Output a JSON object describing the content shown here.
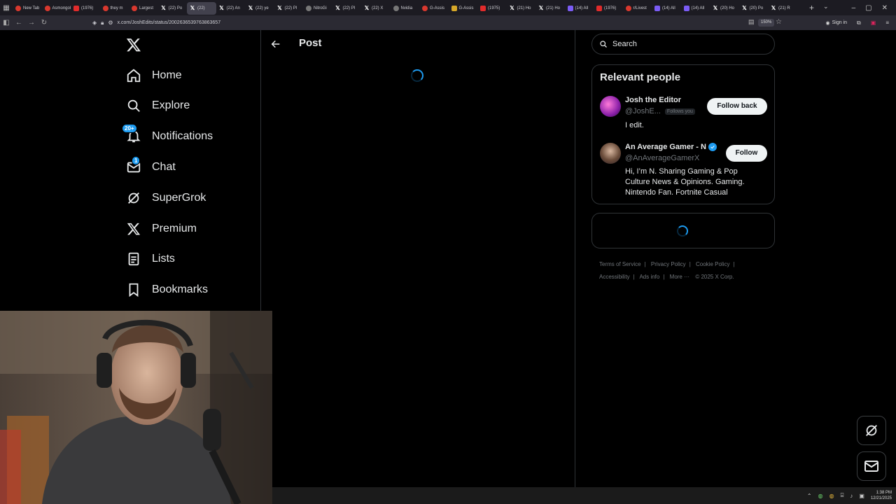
{
  "browser": {
    "tabs": [
      {
        "label": "New Tab",
        "icon": "red"
      },
      {
        "label": "Asmongold",
        "icon": "red"
      },
      {
        "label": "(1976)",
        "icon": "yt"
      },
      {
        "label": "they m",
        "icon": "red"
      },
      {
        "label": "Largest",
        "icon": "red"
      },
      {
        "label": "(22) Po",
        "icon": "x"
      },
      {
        "label": "(22)",
        "icon": "x",
        "active": true
      },
      {
        "label": "(22) An",
        "icon": "x"
      },
      {
        "label": "(22) ye",
        "icon": "x"
      },
      {
        "label": "(22) Pl",
        "icon": "x"
      },
      {
        "label": "NitroGi",
        "icon": "gray"
      },
      {
        "label": "(22) Pl",
        "icon": "x"
      },
      {
        "label": "(22) X",
        "icon": "x"
      },
      {
        "label": "Nvidia",
        "icon": "gray"
      },
      {
        "label": "G-Assis",
        "icon": "red"
      },
      {
        "label": "G-Assis",
        "icon": "yellow"
      },
      {
        "label": "(1975)",
        "icon": "yt"
      },
      {
        "label": "(21) Ho",
        "icon": "x"
      },
      {
        "label": "(21) Ho",
        "icon": "x"
      },
      {
        "label": "(14) All",
        "icon": "purple"
      },
      {
        "label": "(1976)",
        "icon": "yt"
      },
      {
        "label": "r/Livest",
        "icon": "red"
      },
      {
        "label": "(14) All",
        "icon": "purple"
      },
      {
        "label": "(14) All",
        "icon": "purple"
      },
      {
        "label": "(20) Ho",
        "icon": "x"
      },
      {
        "label": "(20) Po",
        "icon": "x"
      },
      {
        "label": "(21) R",
        "icon": "x"
      }
    ],
    "url": "x.com/JoshEdits/status/2002636539763863657",
    "zoom": "150%",
    "sign_in": "Sign in"
  },
  "sidebar": {
    "items": [
      {
        "label": "Home",
        "icon": "home-icon"
      },
      {
        "label": "Explore",
        "icon": "search-icon"
      },
      {
        "label": "Notifications",
        "icon": "bell-icon",
        "badge": "20+"
      },
      {
        "label": "Chat",
        "icon": "mail-icon",
        "badge": "1"
      },
      {
        "label": "SuperGrok",
        "icon": "grok-icon"
      },
      {
        "label": "Premium",
        "icon": "x-logo-icon"
      },
      {
        "label": "Lists",
        "icon": "list-icon"
      },
      {
        "label": "Bookmarks",
        "icon": "bookmark-icon"
      }
    ]
  },
  "main": {
    "title": "Post"
  },
  "right": {
    "search_placeholder": "Search",
    "relevant_title": "Relevant people",
    "people": [
      {
        "name": "Josh the Editor",
        "handle": "@JoshE...",
        "follows_you": "Follows you",
        "bio": "I edit.",
        "button": "Follow back",
        "verified": false
      },
      {
        "name": "An Average Gamer - N",
        "handle": "@AnAverageGamerX",
        "bio": "Hi, I’m N. Sharing Gaming & Pop Culture News & Opinions. Gaming. Nintendo Fan. Fortnite Casual",
        "button": "Follow",
        "verified": true
      }
    ],
    "footer": {
      "terms": "Terms of Service",
      "privacy": "Privacy Policy",
      "cookie": "Cookie Policy",
      "accessibility": "Accessibility",
      "ads": "Ads info",
      "more": "More ···",
      "copyright": "© 2025 X Corp."
    }
  },
  "taskbar": {
    "time": "1:38 PM",
    "date": "12/21/2025"
  },
  "colors": {
    "accent": "#1d9bf0",
    "background": "#000000",
    "border": "#2f3336",
    "muted": "#71767b"
  }
}
